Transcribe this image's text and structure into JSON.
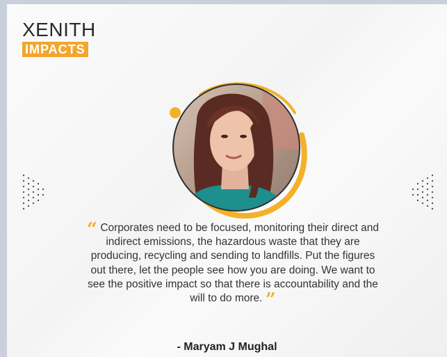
{
  "brand": {
    "line1": "XENITH",
    "line2": "IMPACTS",
    "accent": "#f3a52c"
  },
  "quote": {
    "open_mark": "“",
    "text": "Corporates need to be focused, monitoring their direct and indirect emissions, the hazardous waste that they are producing, recycling and sending to landfills. Put the figures out there, let the people see how you are doing. We want to see the positive impact so that there is accountability and the will to do more.",
    "close_mark": "”"
  },
  "author": "- Maryam J Mughal"
}
